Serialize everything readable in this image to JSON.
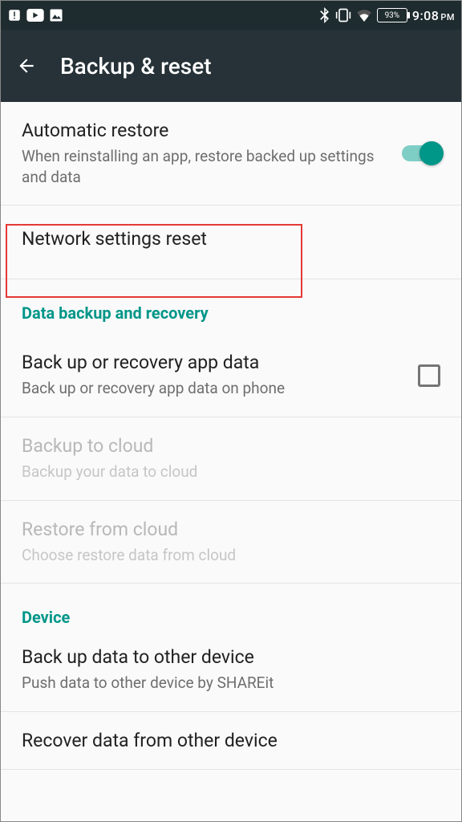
{
  "status": {
    "battery": "93%",
    "time": "9:08",
    "ampm": "PM"
  },
  "header": {
    "title": "Backup & reset"
  },
  "items": {
    "autoRestore": {
      "title": "Automatic restore",
      "sub": "When reinstalling an app, restore backed up settings and data"
    },
    "networkReset": {
      "title": "Network settings reset"
    },
    "section1": "Data backup and recovery",
    "backupApp": {
      "title": "Back up or recovery app data",
      "sub": "Back up or recovery app data on phone"
    },
    "backupCloud": {
      "title": "Backup to cloud",
      "sub": "Backup your data to cloud"
    },
    "restoreCloud": {
      "title": "Restore from cloud",
      "sub": "Choose restore data from cloud"
    },
    "section2": "Device",
    "backupOther": {
      "title": "Back up data to other device",
      "sub": "Push data to other device by SHAREit"
    },
    "recoverOther": {
      "title": "Recover data from other device"
    }
  }
}
